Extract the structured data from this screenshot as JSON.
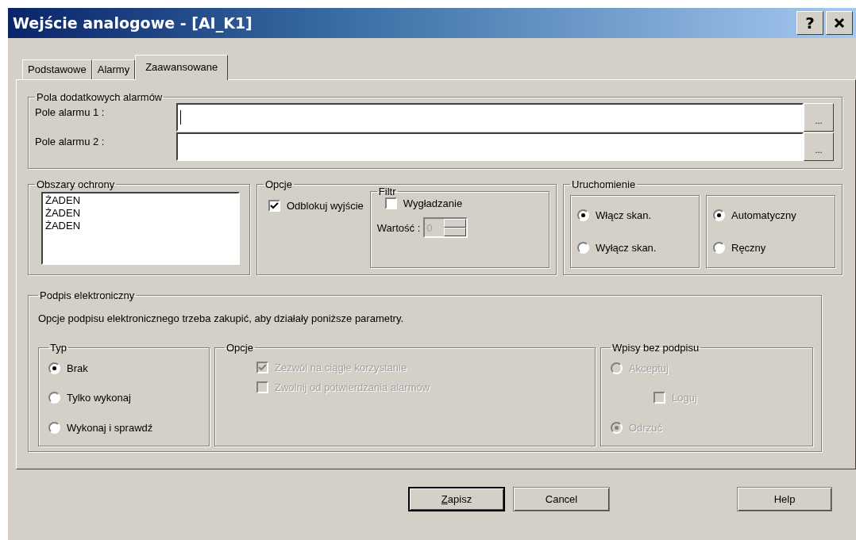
{
  "window": {
    "title": "Wejście analogowe - [AI_K1]",
    "help_button": "?"
  },
  "tabs": [
    {
      "label": "Podstawowe",
      "selected": false
    },
    {
      "label": "Alarmy",
      "selected": false
    },
    {
      "label": "Zaawansowane",
      "selected": true
    }
  ],
  "alarm_fields": {
    "title": "Pola dodatkowych alarmów",
    "fields": [
      {
        "label": "Pole alarmu 1 :",
        "focused": true,
        "browse": "..."
      },
      {
        "label": "Pole alarmu 2 :",
        "focused": false,
        "browse": "..."
      }
    ]
  },
  "protection_areas": {
    "title": "Obszary ochrony",
    "items": [
      "ŻADEN",
      "ŻADEN",
      "ŻADEN"
    ]
  },
  "options": {
    "title": "Opcje",
    "unlock_output": {
      "label": "Odblokuj wyjście",
      "checked": true
    },
    "filter": {
      "title": "Filtr",
      "smoothing": {
        "label": "Wygładzanie",
        "checked": false
      },
      "value_label": "Wartość :",
      "value": "0",
      "value_disabled": true
    }
  },
  "startup": {
    "title": "Uruchomienie",
    "scan": [
      {
        "label": "Włącz skan.",
        "selected": true
      },
      {
        "label": "Wyłącz skan.",
        "selected": false
      }
    ],
    "mode": [
      {
        "label": "Automatyczny",
        "selected": true
      },
      {
        "label": "Ręczny",
        "selected": false
      }
    ]
  },
  "esignature": {
    "title": "Podpis elektroniczny",
    "note": "Opcje podpisu elektronicznego trzeba zakupić, aby działały poniższe parametry.",
    "type": {
      "title": "Typ",
      "items": [
        {
          "label": "Brak",
          "selected": true,
          "disabled": false
        },
        {
          "label": "Tylko wykonaj",
          "selected": false,
          "disabled": false
        },
        {
          "label": "Wykonaj i sprawdź",
          "selected": false,
          "disabled": false
        }
      ]
    },
    "options": {
      "title": "Opcje",
      "items": [
        {
          "label": "Zezwól na ciągłe korzystanie",
          "checked": true,
          "disabled": true
        },
        {
          "label": "Zwolnij od potwierdzania alarmów",
          "checked": false,
          "disabled": true
        }
      ]
    },
    "unsigned": {
      "title": "Wpisy bez podpisu",
      "items": [
        {
          "kind": "radio",
          "label": "Akceptuj",
          "selected": false,
          "disabled": true
        },
        {
          "kind": "checkbox",
          "label": "Loguj",
          "checked": false,
          "disabled": true
        },
        {
          "kind": "radio",
          "label": "Odrzuć",
          "selected": true,
          "disabled": true
        }
      ]
    }
  },
  "buttons": [
    {
      "label": "Zapisz",
      "default": true
    },
    {
      "label": "Cancel",
      "default": false
    },
    {
      "label": "Help",
      "default": false
    }
  ]
}
